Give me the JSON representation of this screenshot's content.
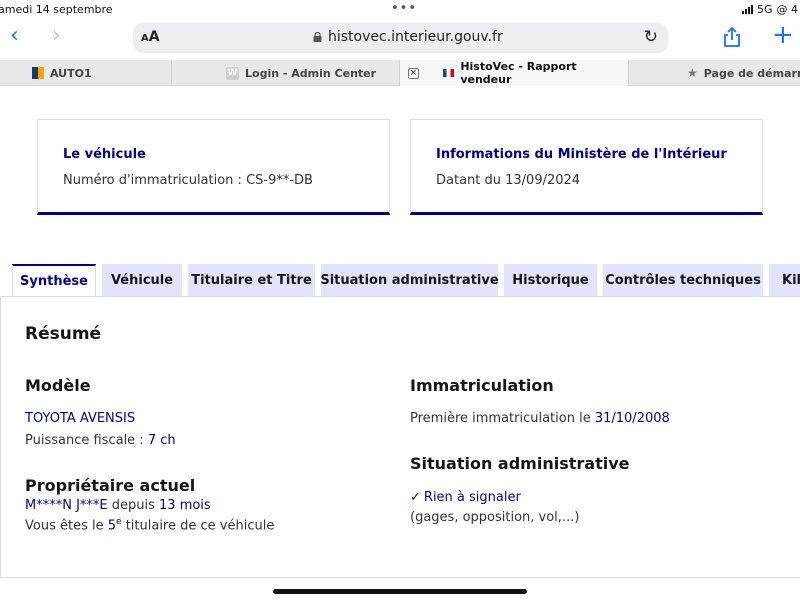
{
  "status": {
    "date": "amedi 14 septembre",
    "network": "5G",
    "extra": "@ 4"
  },
  "browser": {
    "aa_label_small": "A",
    "aa_label_big": "A",
    "url": "histovec.interieur.gouv.fr",
    "tabs": [
      {
        "label": "AUTO1",
        "icon": "auto1-favicon"
      },
      {
        "label": "Login - Admin Center",
        "icon": "w-favicon"
      },
      {
        "label": "HistoVec - Rapport vendeur",
        "icon": "french-flag-favicon",
        "active": true
      },
      {
        "label": "Page de démarrage",
        "icon": "star-icon"
      }
    ]
  },
  "cards": {
    "vehicle": {
      "title": "Le véhicule",
      "text": "Numéro d'immatriculation : CS-9**-DB"
    },
    "ministry": {
      "title": "Informations du Ministère de l'Intérieur",
      "text": "Datant du 13/09/2024"
    }
  },
  "page_tabs": [
    "Synthèse",
    "Véhicule",
    "Titulaire et Titre",
    "Situation administrative",
    "Historique",
    "Contrôles techniques",
    "Kilo"
  ],
  "summary": {
    "title": "Résumé",
    "model": {
      "heading": "Modèle",
      "name": "TOYOTA AVENSIS",
      "power_label": "Puissance fiscale : ",
      "power_value": "7 ch"
    },
    "owner": {
      "heading": "Propriétaire actuel",
      "name": "M****N J***E",
      "since_label": " depuis ",
      "since_value": "13 mois",
      "rank_prefix": "Vous êtes le ",
      "rank_value": "5",
      "rank_sup": "e",
      "rank_suffix": " titulaire de ce véhicule"
    },
    "registration": {
      "heading": "Immatriculation",
      "first_label": "Première immatriculation le ",
      "first_value": "31/10/2008"
    },
    "admin": {
      "heading": "Situation administrative",
      "status": "Rien à signaler",
      "details": "(gages, opposition, vol,...)"
    }
  },
  "colors": {
    "accent": "#000091",
    "tab_bg": "#e3e3fd",
    "link": "#1a73e8"
  }
}
